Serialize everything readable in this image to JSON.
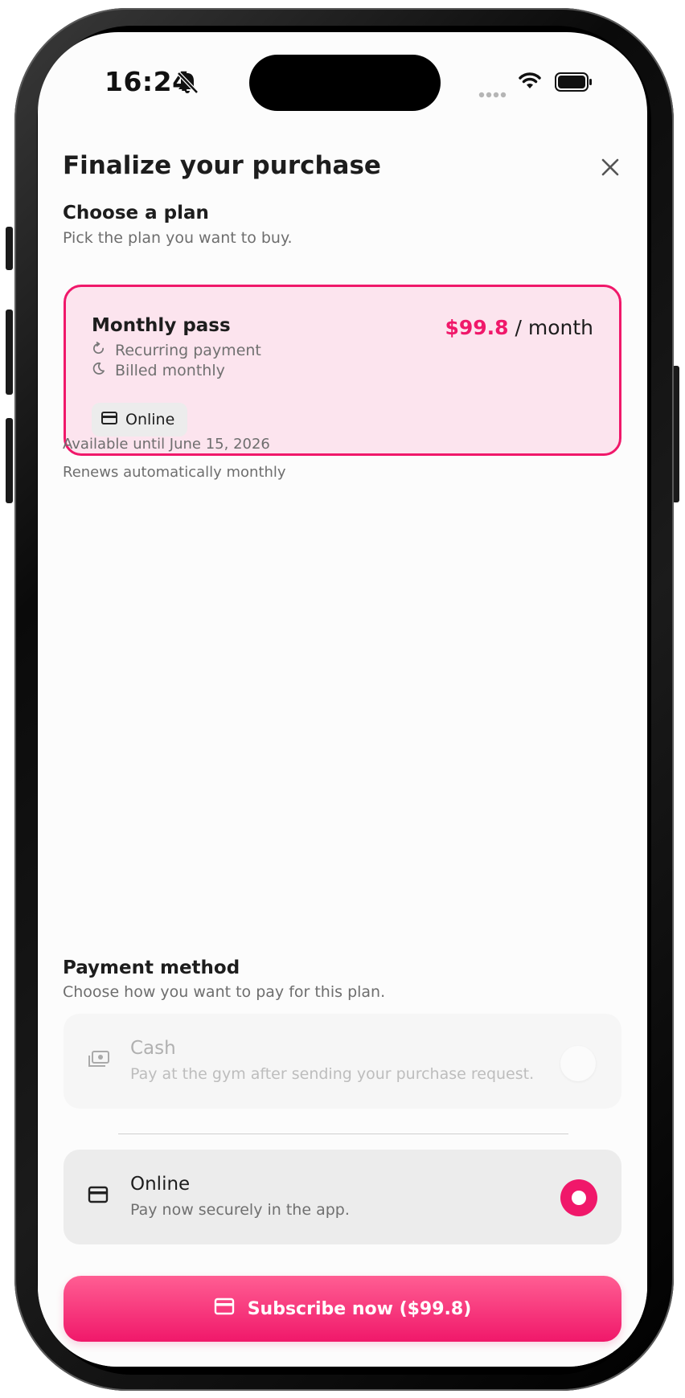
{
  "status_bar": {
    "time": "16:24"
  },
  "header": {
    "title": "Finalize your purchase"
  },
  "plan_section": {
    "title": "Choose a plan",
    "subtitle": "Pick the plan you want to buy."
  },
  "plan": {
    "name": "Monthly pass",
    "price": "$99.8",
    "period": "/ month",
    "features": [
      "Recurring payment",
      "Billed monthly"
    ],
    "chip_label": "Online"
  },
  "info": {
    "availability": "Available until June 15, 2026",
    "renewal": "Renews automatically monthly"
  },
  "payment_section": {
    "title": "Payment method",
    "subtitle": "Choose how you want to pay for this plan."
  },
  "payment_methods": [
    {
      "name": "Cash",
      "description": "Pay at the gym after sending your purchase request.",
      "selected": false,
      "icon": "cash-icon"
    },
    {
      "name": "Online",
      "description": "Pay now securely in the app.",
      "selected": true,
      "icon": "card-icon"
    }
  ],
  "cta": {
    "label": "Subscribe now ($99.8)"
  },
  "colors": {
    "accent": "#f0186a",
    "card_bg": "#fce4ee",
    "chip_bg": "#ececec"
  }
}
